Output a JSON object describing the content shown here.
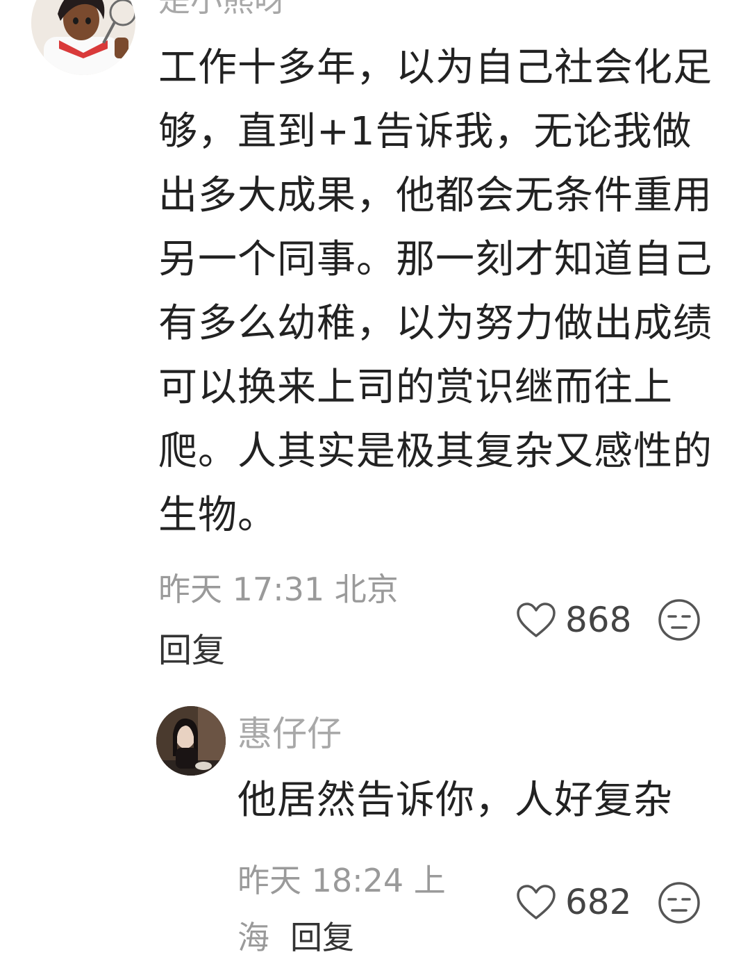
{
  "main_comment": {
    "username": "是小熊呀",
    "avatar_icon": "tennis-girl-avatar",
    "text": "工作十多年，以为自己社会化足够，直到+1告诉我，无论我做出多大成果，他都会无条件重用另一个同事。那一刻才知道自己有多么幼稚，以为努力做出成绩可以换来上司的赏识继而往上爬。人其实是极其复杂又感性的生物。",
    "meta": "昨天 17:31 北京",
    "reply_label": "回复",
    "like_icon": "heart-outline-icon",
    "like_count": "868",
    "dislike_icon": "unamused-face-icon"
  },
  "reply_comment": {
    "username": "惠仔仔",
    "avatar_icon": "person-photo-avatar",
    "text": "他居然告诉你，人好复杂",
    "meta": "昨天 18:24 上海",
    "reply_label": "回复",
    "like_icon": "heart-outline-icon",
    "like_count": "682",
    "dislike_icon": "unamused-face-icon"
  },
  "colors": {
    "text_primary": "#222222",
    "text_muted": "#9a9a9a",
    "icon_stroke": "#555555"
  }
}
